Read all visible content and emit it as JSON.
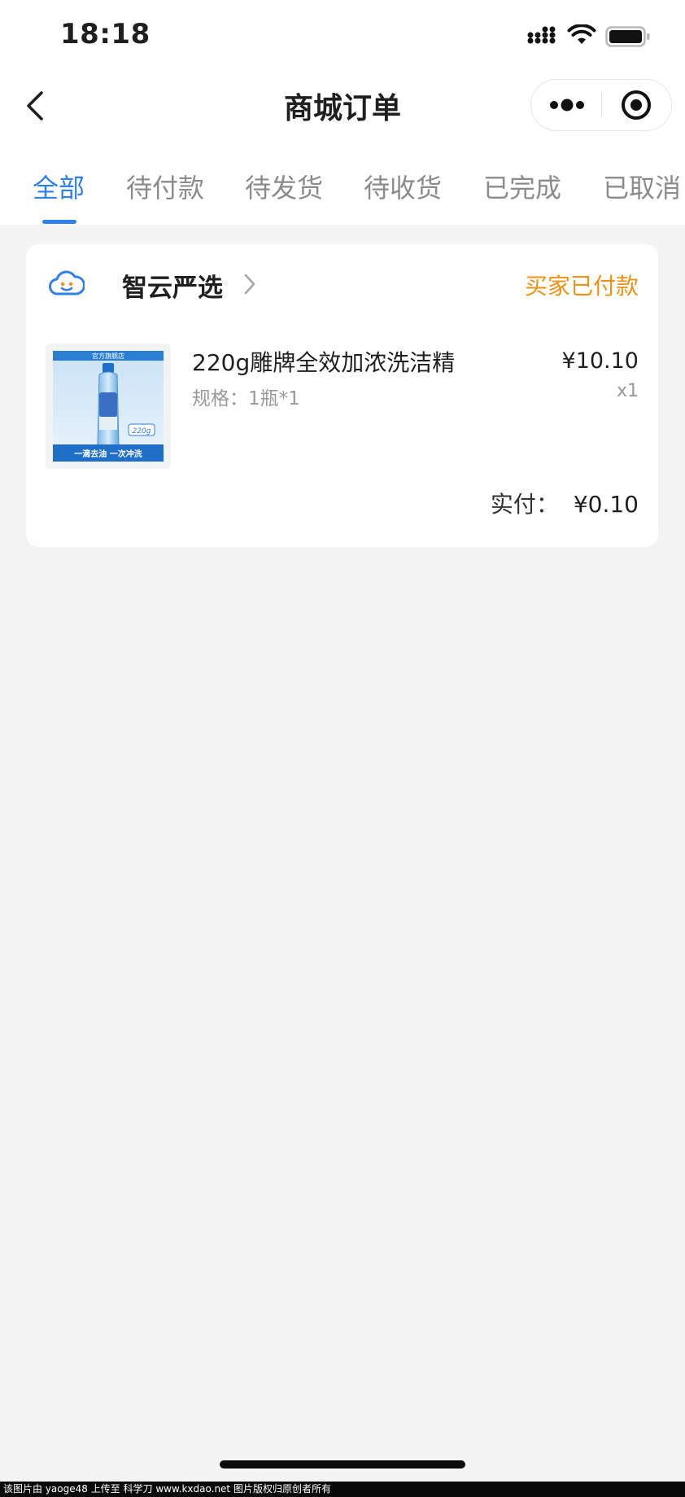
{
  "status_bar": {
    "time": "18:18"
  },
  "nav": {
    "title": "商城订单"
  },
  "tabs": [
    {
      "label": "全部",
      "active": true
    },
    {
      "label": "待付款",
      "active": false
    },
    {
      "label": "待发货",
      "active": false
    },
    {
      "label": "待收货",
      "active": false
    },
    {
      "label": "已完成",
      "active": false
    },
    {
      "label": "已取消",
      "active": false
    }
  ],
  "order": {
    "store_name": "智云严选",
    "status": "买家已付款",
    "product": {
      "name": "220g雕牌全效加浓洗洁精",
      "spec": "规格：1瓶*1",
      "price": "¥10.10",
      "quantity": "x1",
      "image_texts": {
        "badge": "官方旗舰店",
        "weight": "220g",
        "slogan": "一滴去油 一次冲洗"
      }
    },
    "paid_label": "实付：",
    "paid_amount": "¥0.10"
  },
  "watermark": "该图片由 yaoge48 上传至 科学刀 www.kxdao.net 图片版权归原创者所有",
  "colors": {
    "accent": "#2f80ed",
    "status_orange": "#f39014",
    "page_bg": "#f4f4f4"
  }
}
